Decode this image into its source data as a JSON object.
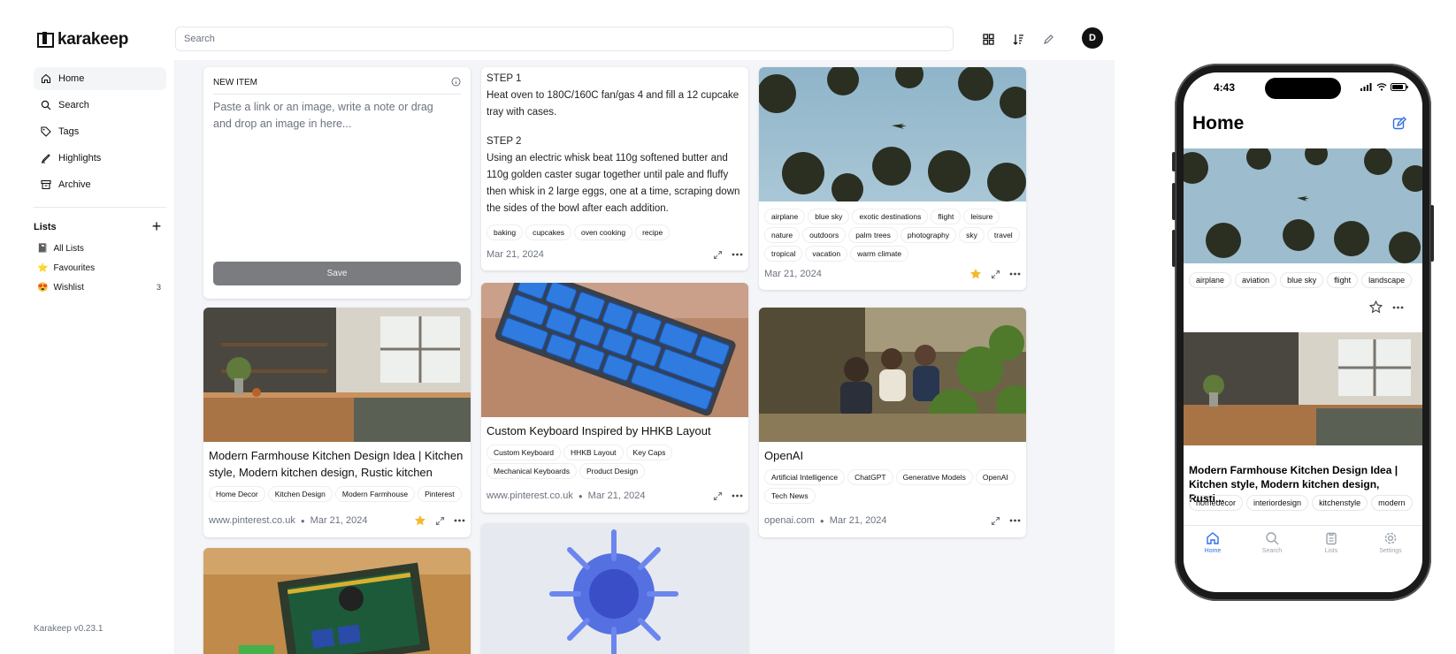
{
  "app": {
    "name": "karakeep",
    "version": "Karakeep v0.23.1"
  },
  "header": {
    "search_placeholder": "Search",
    "avatar_initial": "D"
  },
  "sidebar": {
    "items": [
      {
        "label": "Home"
      },
      {
        "label": "Search"
      },
      {
        "label": "Tags"
      },
      {
        "label": "Highlights"
      },
      {
        "label": "Archive"
      }
    ],
    "lists_heading": "Lists",
    "lists": [
      {
        "emoji": "📓",
        "label": "All Lists",
        "count": ""
      },
      {
        "emoji": "⭐",
        "label": "Favourites",
        "count": ""
      },
      {
        "emoji": "😍",
        "label": "Wishlist",
        "count": "3"
      }
    ]
  },
  "new_item": {
    "label": "NEW ITEM",
    "placeholder": "Paste a link or an image, write a note or drag and drop an image in here...",
    "save_label": "Save"
  },
  "cards": {
    "note": {
      "step1_heading": "STEP 1",
      "step1_text": "Heat oven to 180C/160C fan/gas 4 and fill a 12 cupcake tray with cases.",
      "step2_heading": "STEP 2",
      "step2_text": "Using an electric whisk beat 110g softened butter and 110g golden caster sugar together until pale and fluffy then whisk in 2 large eggs, one at a time, scraping down the sides of the bowl after each addition.",
      "tags": [
        "baking",
        "cupcakes",
        "oven cooking",
        "recipe"
      ],
      "date": "Mar 21, 2024"
    },
    "palms": {
      "tags": [
        "airplane",
        "blue sky",
        "exotic destinations",
        "flight",
        "leisure",
        "nature",
        "outdoors",
        "palm trees",
        "photography",
        "sky",
        "travel",
        "tropical",
        "vacation",
        "warm climate"
      ],
      "date": "Mar 21, 2024"
    },
    "kitchen": {
      "title": "Modern Farmhouse Kitchen Design Idea | Kitchen style, Modern kitchen design, Rustic kitchen",
      "tags": [
        "Home Decor",
        "Kitchen Design",
        "Modern Farmhouse",
        "Pinterest"
      ],
      "source": "www.pinterest.co.uk",
      "date": "Mar 21, 2024"
    },
    "keyboard": {
      "title": "Custom Keyboard Inspired by HHKB Layout",
      "tags": [
        "Custom Keyboard",
        "HHKB Layout",
        "Key Caps",
        "Mechanical Keyboards",
        "Product Design"
      ],
      "source": "www.pinterest.co.uk",
      "date": "Mar 21, 2024"
    },
    "openai": {
      "title": "OpenAI",
      "tags": [
        "Artificial Intelligence",
        "ChatGPT",
        "Generative Models",
        "OpenAI",
        "Tech News"
      ],
      "source": "openai.com",
      "date": "Mar 21, 2024"
    }
  },
  "phone": {
    "time": "4:43",
    "title": "Home",
    "card1_tags": [
      "airplane",
      "aviation",
      "blue sky",
      "flight",
      "landscape"
    ],
    "card2_title": "Modern Farmhouse Kitchen Design Idea | Kitchen style, Modern kitchen design, Rusti...",
    "card2_tags": [
      "homedecor",
      "interiordesign",
      "kitchenstyle",
      "modern"
    ],
    "tabs": [
      "Home",
      "Search",
      "Lists",
      "Settings"
    ]
  },
  "colors": {
    "accent_star": "#f5b82e",
    "phone_accent": "#2f6fde",
    "save_button": "#7a7c80"
  }
}
